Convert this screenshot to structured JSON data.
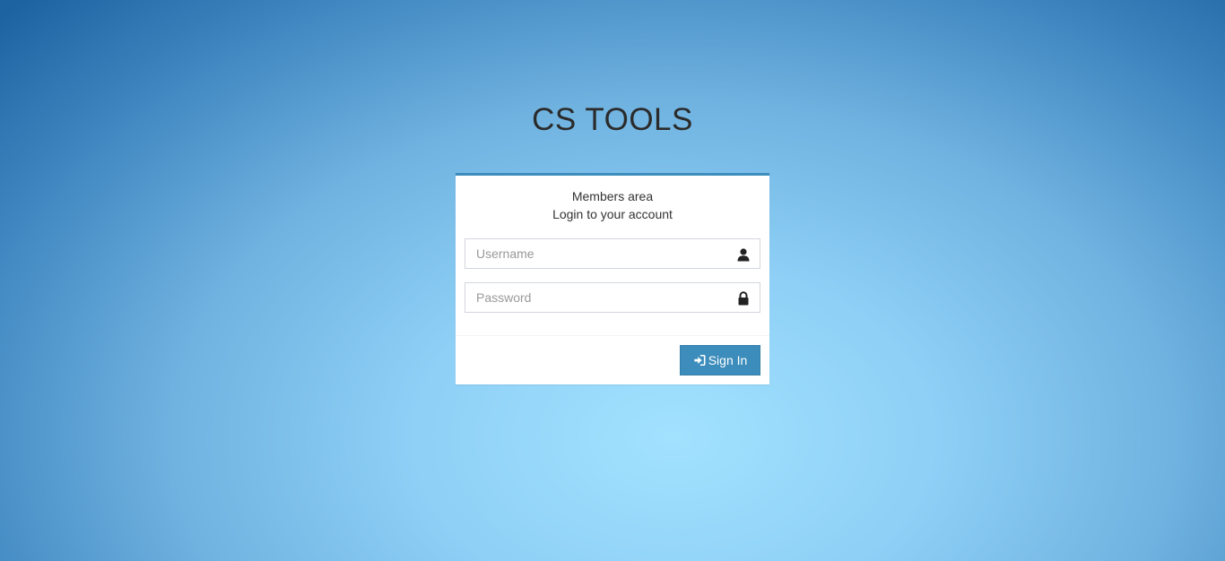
{
  "app": {
    "title": "CS TOOLS"
  },
  "login_box": {
    "heading": "Members area",
    "subheading": "Login to your account",
    "username": {
      "value": "",
      "placeholder": "Username",
      "icon": "user-icon"
    },
    "password": {
      "value": "",
      "placeholder": "Password",
      "icon": "lock-icon"
    },
    "signin_button": {
      "label": "Sign In",
      "icon": "sign-in-icon"
    }
  },
  "colors": {
    "accent": "#3c8dbc",
    "title_text": "#2b2b2b",
    "background_light": "#a2e2ff",
    "background_dark": "#1d63a2"
  }
}
